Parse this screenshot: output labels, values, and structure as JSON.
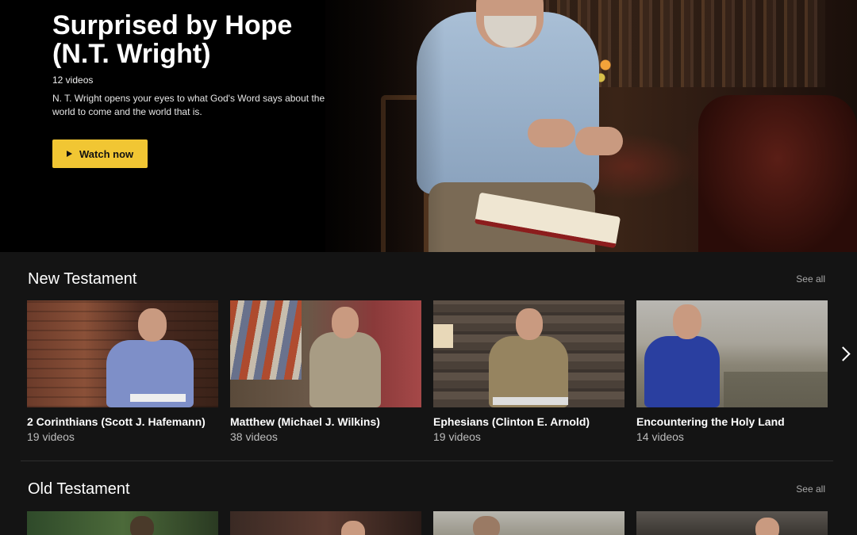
{
  "hero": {
    "title": "Surprised by Hope (N.T. Wright)",
    "count": "12 videos",
    "description": "N. T. Wright opens your eyes to what God's Word says about the world to come and the world that is.",
    "watch_label": "Watch now"
  },
  "sections": [
    {
      "title": "New Testament",
      "see_all": "See all",
      "items": [
        {
          "title": "2 Corinthians (Scott J. Hafemann)",
          "count": "19 videos"
        },
        {
          "title": "Matthew (Michael J. Wilkins)",
          "count": "38 videos"
        },
        {
          "title": "Ephesians (Clinton E. Arnold)",
          "count": "19 videos"
        },
        {
          "title": "Encountering the Holy Land",
          "count": "14 videos"
        }
      ]
    },
    {
      "title": "Old Testament",
      "see_all": "See all"
    }
  ],
  "colors": {
    "accent": "#f1c633",
    "background": "#141414"
  }
}
